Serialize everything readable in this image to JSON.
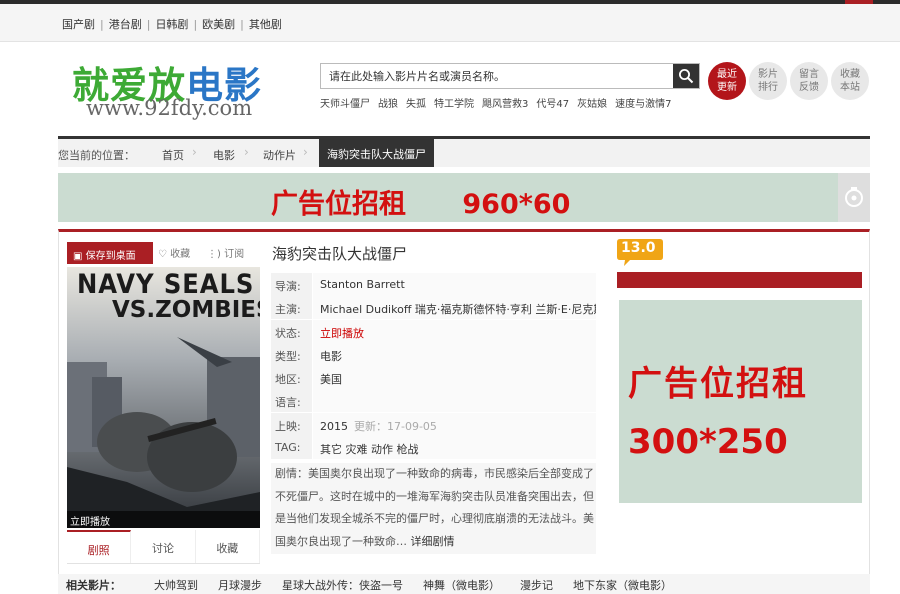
{
  "topnav": {
    "items": [
      "国产剧",
      "港台剧",
      "日韩剧",
      "欧美剧",
      "其他剧"
    ],
    "separator": "|"
  },
  "logo": {
    "text_green": "就爱放",
    "text_blue": "电影",
    "url": "www.92fdy.com"
  },
  "search": {
    "placeholder": "请在此处输入影片片名或演员名称。",
    "hotwords": [
      "天师斗僵尸",
      "战狼",
      "失孤",
      "特工学院",
      "飓风营救3",
      "代号47",
      "灰姑娘",
      "速度与激情7"
    ]
  },
  "quick_links": [
    {
      "line1": "最近",
      "line2": "更新",
      "style": "red"
    },
    {
      "line1": "影片",
      "line2": "排行",
      "style": "grey"
    },
    {
      "line1": "留言",
      "line2": "反馈",
      "style": "grey"
    },
    {
      "line1": "收藏",
      "line2": "本站",
      "style": "grey"
    }
  ],
  "breadcrumb": {
    "lead": "您当前的位置：",
    "items": [
      "首页",
      "电影",
      "动作片"
    ],
    "current": "海豹突击队大战僵尸"
  },
  "ad_banner": {
    "text": "广告位招租      960*60"
  },
  "movie": {
    "save_label": "保存到桌面",
    "collect_label": "收藏",
    "subscribe_label": "订阅",
    "poster_title_line1": "NAVY SEALS",
    "poster_title_line2": "VS.ZOMBIES",
    "poster_play": "立即播放",
    "tabs": [
      "剧照",
      "讨论",
      "收藏"
    ],
    "title": "海豹突击队大战僵尸",
    "info": {
      "director_k": "导演:",
      "director": "Stanton  Barrett",
      "cast_k": "主演:",
      "cast": "Michael  Dudikoff  瑞克·福克斯德怀特·亨利  兰斯·E·尼克斯",
      "status_k": "状态:",
      "status": "立即播放",
      "type_k": "类型:",
      "type": "电影",
      "region_k": "地区:",
      "region": "美国",
      "language_k": "语言:",
      "language": "",
      "release_k": "上映:",
      "release": "2015",
      "updated": "更新：17-09-05",
      "tag_k": "TAG:",
      "tags": "其它  灾难  动作  枪战"
    },
    "plot_k": "剧情：",
    "plot": "美国奥尔良出现了一种致命的病毒，市民感染后全部变成了不死僵尸。这时在城中的一堆海军海豹突击队员准备突围出去，但是当他们发现全城杀不完的僵尸时，心理彻底崩溃的无法战斗。美国奥尔良出现了一种致命…",
    "plot_more": "详细剧情",
    "score": "13.0"
  },
  "ad_side": {
    "line1": "广告位招租",
    "line2": "300*250"
  },
  "related": {
    "label": "相关影片：",
    "items": [
      "大帅驾到",
      "月球漫步",
      "星球大战外传：侠盗一号",
      "神舞（微电影）",
      "漫步记",
      "地下东家（微电影）"
    ]
  },
  "colors": {
    "accent": "#aa1f24",
    "ad_bg": "#cbdcd1",
    "ad_text": "#d31010",
    "logo_green": "#3daa35",
    "logo_blue": "#2a76c6"
  }
}
